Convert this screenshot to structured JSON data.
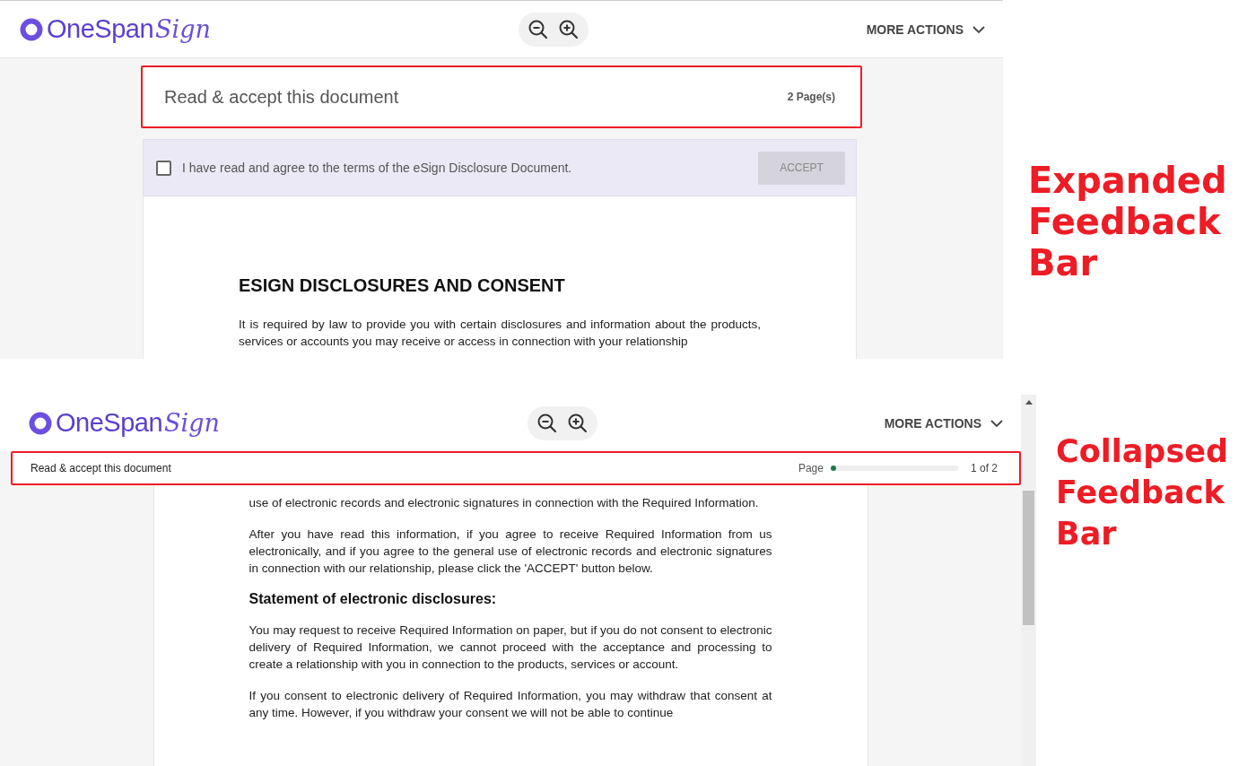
{
  "panels": [
    {
      "kind": "expanded",
      "header": {
        "logo_main": "OneSpan",
        "logo_script": "Sign",
        "more_actions": "MORE ACTIONS"
      },
      "feedback_bar": {
        "title": "Read & accept this document",
        "pages": "2 Page(s)"
      },
      "accept_bar": {
        "label": "I have read and agree to the terms of the eSign Disclosure Document.",
        "checked": false,
        "button": "ACCEPT",
        "button_disabled": true
      },
      "document": [
        {
          "kind": "heading",
          "text": "ESIGN DISCLOSURES AND CONSENT"
        },
        {
          "kind": "paragraph",
          "text": "It is required by law to provide you with certain disclosures and information about the products, services or accounts you may receive or access in connection with your relationship"
        }
      ],
      "annotation": "Expanded Feedback Bar"
    },
    {
      "kind": "collapsed",
      "header": {
        "logo_main": "OneSpan",
        "logo_script": "Sign",
        "more_actions": "MORE ACTIONS"
      },
      "feedback_bar": {
        "title": "Read & accept this document",
        "page_label": "Page",
        "level": 0.02,
        "reading": "1 of 2"
      },
      "document": [
        {
          "kind": "paragraph",
          "text": "use of electronic records and electronic signatures in connection with the Required Information."
        },
        {
          "kind": "paragraph",
          "text": "After you have read this information, if you agree to receive Required Information from us electronically, and if you agree to the general use of electronic records and electronic signatures in connection with our relationship, please click the 'ACCEPT' button below."
        },
        {
          "kind": "subheading",
          "text": "Statement of electronic disclosures:"
        },
        {
          "kind": "paragraph",
          "text": "You may request to receive Required Information on paper, but if you do not consent to electronic delivery of Required Information, we cannot proceed with the acceptance and processing to create a relationship with you in connection to the products, services or account."
        },
        {
          "kind": "paragraph",
          "text": "If you consent to electronic delivery of Required Information, you may withdraw that consent at any time. However, if you withdraw your consent we will not be able to continue"
        }
      ],
      "annotation": "Collapsed Feedback Bar"
    }
  ]
}
